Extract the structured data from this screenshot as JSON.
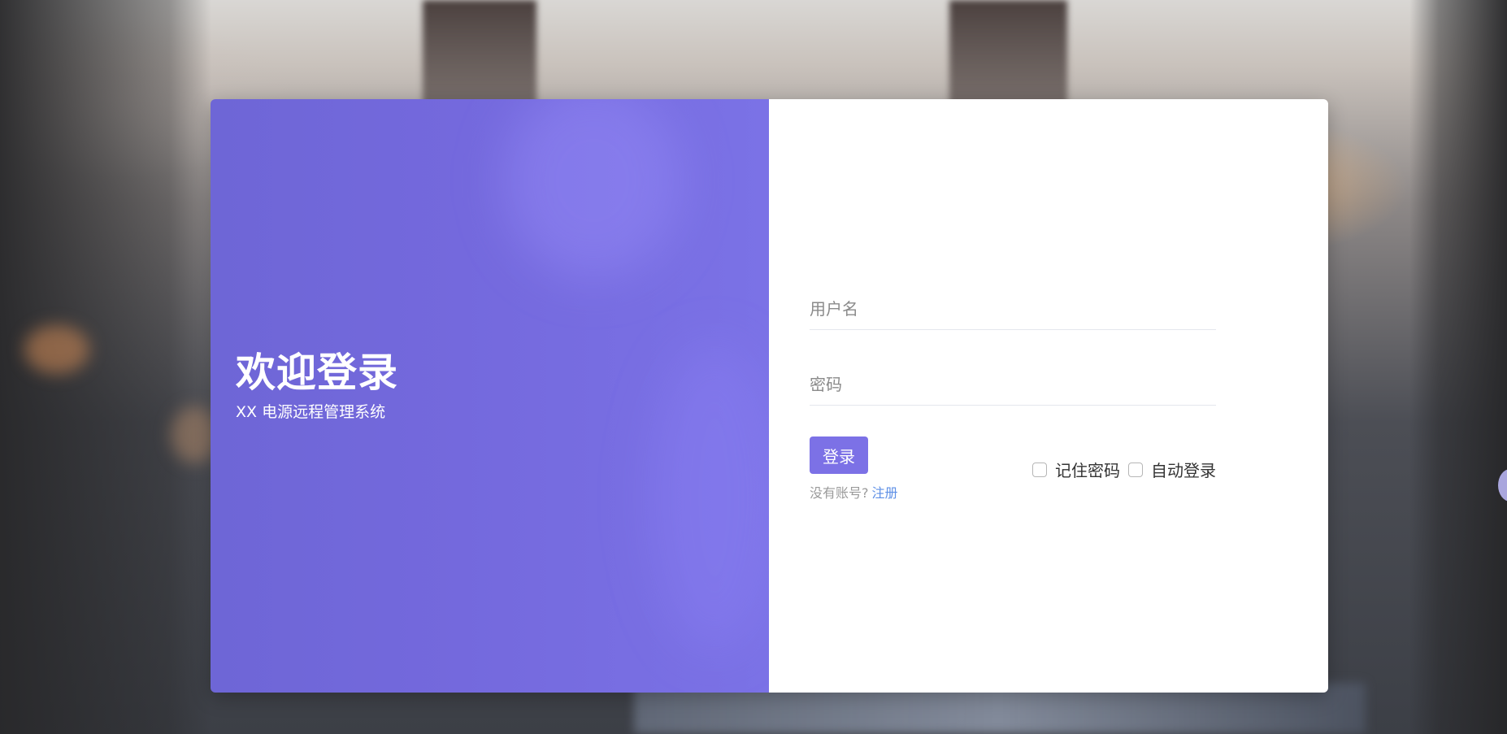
{
  "welcome": {
    "title": "欢迎登录",
    "subtitle": "XX 电源远程管理系统"
  },
  "form": {
    "username_placeholder": "用户名",
    "password_placeholder": "密码",
    "login_label": "登录",
    "remember_label": "记住密码",
    "auto_login_label": "自动登录",
    "no_account_text": "没有账号?",
    "register_label": "注册"
  },
  "colors": {
    "accent": "#7c71e6",
    "panel_purple": "#7469dd",
    "link": "#5d8fe6"
  }
}
